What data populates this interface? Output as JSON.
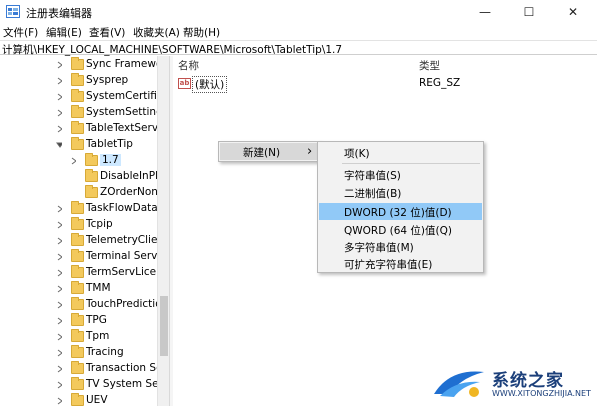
{
  "window": {
    "title": "注册表编辑器",
    "minimize": "—",
    "maximize": "☐",
    "close": "✕"
  },
  "menu": [
    "文件(F)",
    "编辑(E)",
    "查看(V)",
    "收藏夹(A)",
    "帮助(H)"
  ],
  "address": "计算机\\HKEY_LOCAL_MACHINE\\SOFTWARE\\Microsoft\\TabletTip\\1.7",
  "tree": [
    {
      "label": "Sync Framework",
      "expand": "collapsed"
    },
    {
      "label": "Sysprep",
      "expand": "collapsed"
    },
    {
      "label": "SystemCertificates",
      "expand": "collapsed"
    },
    {
      "label": "SystemSettings",
      "expand": "collapsed"
    },
    {
      "label": "TableTextService",
      "expand": "collapsed"
    },
    {
      "label": "TabletTip",
      "expand": "expanded"
    },
    {
      "label": "1.7",
      "expand": "collapsed",
      "selected": true
    },
    {
      "label": "DisableInPla",
      "expand": "none"
    },
    {
      "label": "ZOrderNonC",
      "expand": "none"
    },
    {
      "label": "TaskFlowDataEr",
      "expand": "collapsed"
    },
    {
      "label": "Tcpip",
      "expand": "collapsed"
    },
    {
      "label": "TelemetryClient",
      "expand": "collapsed"
    },
    {
      "label": "Terminal Server",
      "expand": "collapsed"
    },
    {
      "label": "TermServLicens",
      "expand": "collapsed"
    },
    {
      "label": "TMM",
      "expand": "collapsed"
    },
    {
      "label": "TouchPrediction",
      "expand": "collapsed"
    },
    {
      "label": "TPG",
      "expand": "collapsed"
    },
    {
      "label": "Tpm",
      "expand": "collapsed"
    },
    {
      "label": "Tracing",
      "expand": "collapsed"
    },
    {
      "label": "Transaction Ser",
      "expand": "collapsed"
    },
    {
      "label": "TV System Serv",
      "expand": "collapsed"
    },
    {
      "label": "UEV",
      "expand": "collapsed"
    }
  ],
  "list": {
    "col_name": "名称",
    "col_type": "类型",
    "row": {
      "icon_text": "ab",
      "name": "(默认)",
      "type": "REG_SZ"
    }
  },
  "context_menu": {
    "parent": "新建(N)",
    "arrow": "›",
    "items": [
      "项(K)",
      "字符串值(S)",
      "二进制值(B)",
      "DWORD (32 位)值(D)",
      "QWORD (64 位)值(Q)",
      "多字符串值(M)",
      "可扩充字符串值(E)"
    ],
    "highlighted_index": 3
  },
  "watermark": {
    "text": "系统之家",
    "url": "WWW.XITONGZHIJIA.NET"
  }
}
